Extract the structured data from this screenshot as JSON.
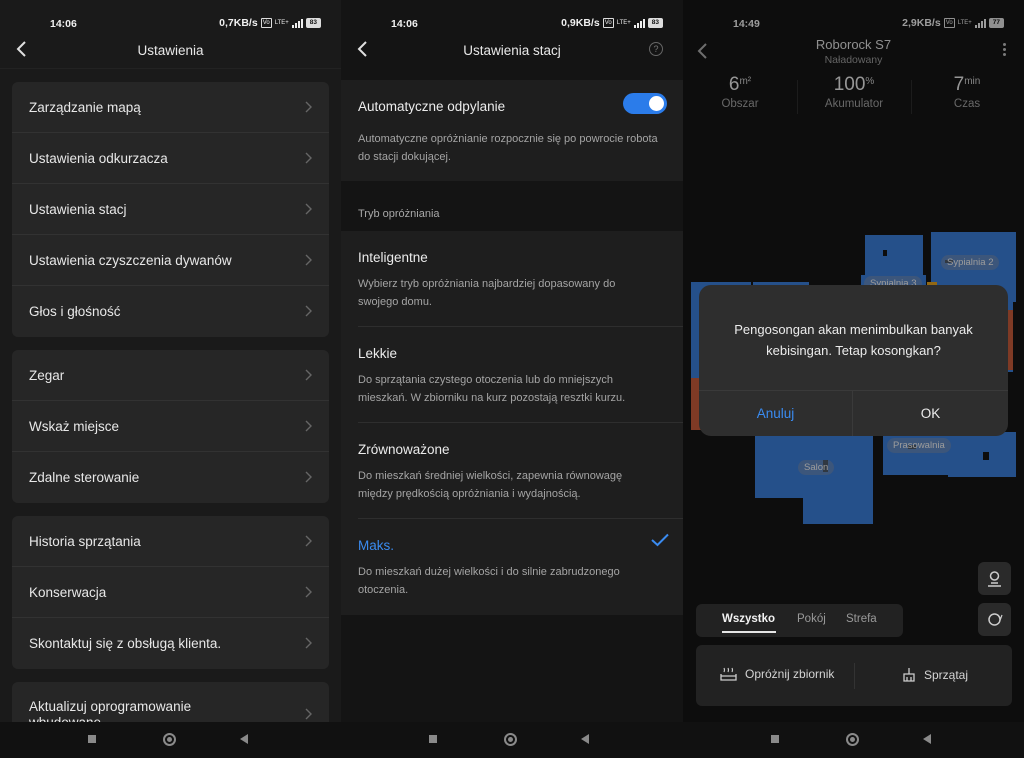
{
  "panel1": {
    "status": {
      "time": "14:06",
      "speed": "0,7KB/s",
      "vo": "Vo",
      "lte": "LTE+",
      "battery": "83"
    },
    "title": "Ustawienia",
    "groups": [
      [
        "Zarządzanie mapą",
        "Ustawienia odkurzacza",
        "Ustawienia stacj",
        "Ustawienia czyszczenia dywanów",
        "Głos i głośność"
      ],
      [
        "Zegar",
        "Wskaż miejsce",
        "Zdalne sterowanie"
      ],
      [
        "Historia sprzątania",
        "Konserwacja",
        "Skontaktuj się z obsługą klienta."
      ],
      [
        "Aktualizuj oprogramowanie wbudowane"
      ]
    ]
  },
  "panel2": {
    "status": {
      "time": "14:06",
      "speed": "0,9KB/s",
      "vo": "Vo",
      "lte": "LTE+",
      "battery": "83"
    },
    "title": "Ustawienia stacj",
    "help": "?",
    "auto": {
      "title": "Automatyczne odpylanie",
      "desc": "Automatyczne opróżnianie rozpocznie się po powrocie robota do stacji dokującej.",
      "enabled": true
    },
    "section_label": "Tryb opróżniania",
    "options": [
      {
        "title": "Inteligentne",
        "desc": "Wybierz tryb opróżniania najbardziej dopasowany do swojego domu.",
        "selected": false
      },
      {
        "title": "Lekkie",
        "desc": "Do sprzątania czystego otoczenia lub do mniejszych mieszkań. W zbiorniku na kurz pozostają resztki kurzu.",
        "selected": false
      },
      {
        "title": "Zrównoważone",
        "desc": "Do mieszkań średniej wielkości, zapewnia równowagę między prędkością opróżniania i wydajnością.",
        "selected": false
      },
      {
        "title": "Maks.",
        "desc": "Do mieszkań dużej wielkości i do silnie zabrudzonego otoczenia.",
        "selected": true
      }
    ],
    "accent": "#2b7cea"
  },
  "panel3": {
    "status": {
      "time": "14:49",
      "speed": "2,9KB/s",
      "vo": "Vo",
      "lte": "LTE+",
      "battery": "77"
    },
    "device_name": "Roborock S7",
    "device_status": "Naładowany",
    "stats": [
      {
        "value": "6",
        "unit": "m²",
        "label": "Obszar"
      },
      {
        "value": "100",
        "unit": "%",
        "label": "Akumulator"
      },
      {
        "value": "7",
        "unit": "min",
        "label": "Czas"
      }
    ],
    "rooms": [
      "Sypialnia 2",
      "Sypialnia 3",
      "Prasowalnia",
      "Salon"
    ],
    "dialog": {
      "message": "Pengosongan akan menimbulkan banyak kebisingan. Tetap kosongkan?",
      "cancel": "Anuluj",
      "ok": "OK"
    },
    "tabs": [
      "Wszystko",
      "Pokój",
      "Strefa"
    ],
    "actions": [
      "Opróżnij zbiornik",
      "Sprzątaj"
    ],
    "colors": {
      "room_blue": "#3a7bd5",
      "room_orange": "#c4593a",
      "accent": "#3a8bf0"
    }
  }
}
